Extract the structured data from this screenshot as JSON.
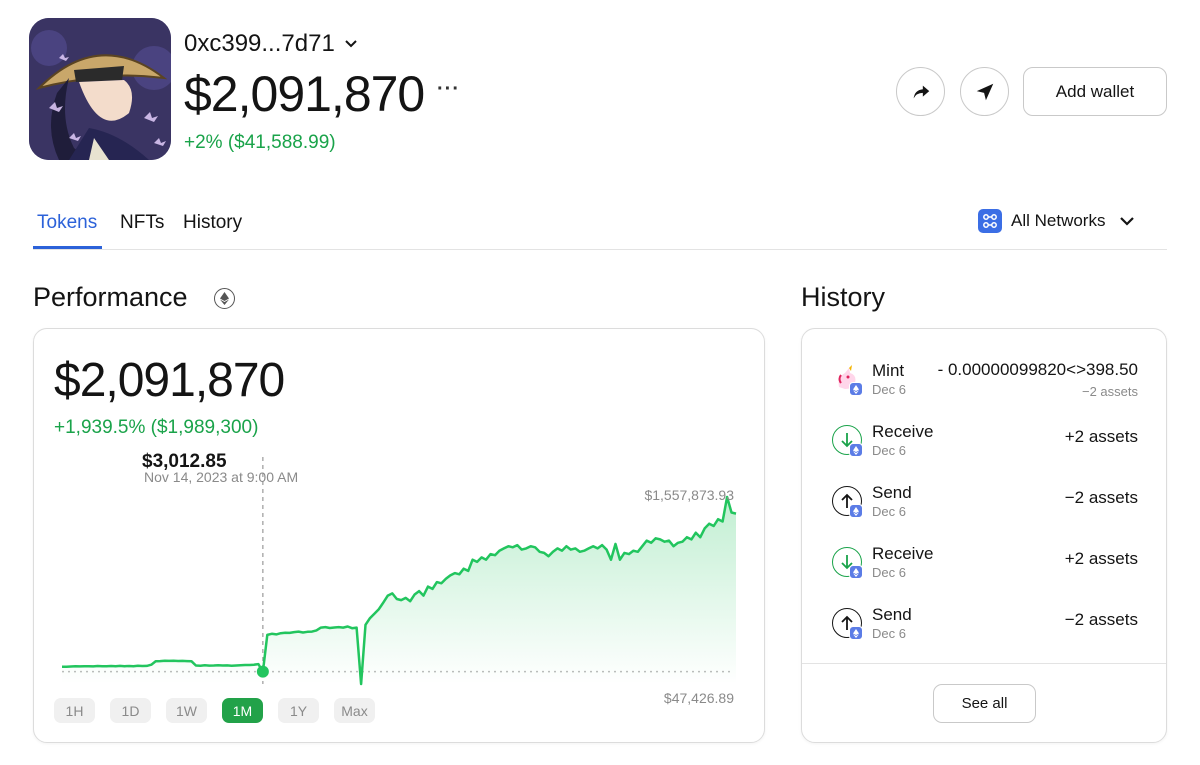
{
  "wallet": {
    "address": "0xc399...7d71",
    "balance": "$2,091,870",
    "change": "+2% ($41,588.99)",
    "more_label": "···",
    "add_wallet_label": "Add wallet"
  },
  "tabs": [
    {
      "label": "Tokens",
      "active": true
    },
    {
      "label": "NFTs",
      "active": false
    },
    {
      "label": "History",
      "active": false
    }
  ],
  "network_filter": {
    "label": "All Networks"
  },
  "performance": {
    "title": "Performance",
    "value": "$2,091,870",
    "change": "+1,939.5% ($1,989,300)",
    "hover_value": "$3,012.85",
    "hover_date": "Nov 14, 2023 at 9:00 AM",
    "max_label": "$1,557,873.93",
    "min_label": "$47,426.89",
    "ranges": [
      {
        "label": "1H",
        "active": false
      },
      {
        "label": "1D",
        "active": false
      },
      {
        "label": "1W",
        "active": false
      },
      {
        "label": "1M",
        "active": true
      },
      {
        "label": "1Y",
        "active": false
      },
      {
        "label": "Max",
        "active": false
      }
    ]
  },
  "history": {
    "title": "History",
    "see_all_label": "See all",
    "items": [
      {
        "type": "Mint",
        "date": "Dec 6",
        "amount": "- 0.00000099820<>398.50",
        "sub": "−2 assets",
        "icon": "unicorn-icon"
      },
      {
        "type": "Receive",
        "date": "Dec 6",
        "amount": "+2 assets",
        "sub": "",
        "icon": "arrow-down-icon"
      },
      {
        "type": "Send",
        "date": "Dec 6",
        "amount": "−2 assets",
        "sub": "",
        "icon": "arrow-up-icon"
      },
      {
        "type": "Receive",
        "date": "Dec 6",
        "amount": "+2 assets",
        "sub": "",
        "icon": "arrow-down-icon"
      },
      {
        "type": "Send",
        "date": "Dec 6",
        "amount": "−2 assets",
        "sub": "",
        "icon": "arrow-up-icon"
      }
    ]
  },
  "colors": {
    "accent_blue": "#2c62d9",
    "positive_green": "#1aa34a",
    "chart_line": "#22c55e",
    "network_icon": "#3b6ee5"
  },
  "chart_data": {
    "type": "line",
    "series": [
      {
        "values": [
          47427,
          47427,
          49000,
          51000,
          50000,
          51000,
          52000,
          50000,
          53000,
          52000,
          51000,
          53000,
          52000,
          54000,
          52000,
          53000,
          52000,
          55000,
          53000,
          54000,
          65000,
          95000,
          97000,
          100000,
          99000,
          100000,
          98000,
          99000,
          97000,
          96000,
          58000,
          56000,
          60000,
          57000,
          58000,
          60000,
          58000,
          59000,
          56000,
          58000,
          60000,
          62000,
          62000,
          65000,
          70000,
          3012.85,
          330000,
          340000,
          335000,
          345000,
          350000,
          348000,
          355000,
          360000,
          352000,
          358000,
          360000,
          370000,
          395000,
          400000,
          392000,
          396000,
          400000,
          395000,
          405000,
          390000,
          395000,
          0,
          420000,
          480000,
          520000,
          560000,
          620000,
          680000,
          700000,
          650000,
          640000,
          660000,
          630000,
          690000,
          720000,
          680000,
          760000,
          740000,
          800000,
          790000,
          830000,
          860000,
          880000,
          870000,
          920000,
          900000,
          1000000,
          980000,
          1020000,
          1000000,
          1050000,
          1040000,
          1080000,
          1100000,
          1120000,
          1110000,
          1130000,
          1090000,
          1100000,
          1120000,
          1110000,
          1070000,
          1060000,
          1030000,
          1070000,
          1100000,
          1080000,
          1120000,
          1090000,
          1100000,
          1070000,
          1080000,
          1100000,
          1120000,
          1100000,
          1130000,
          1090000,
          1000000,
          1140000,
          1000000,
          1060000,
          1050000,
          1080000,
          1070000,
          1120000,
          1170000,
          1150000,
          1190000,
          1180000,
          1160000,
          1170000,
          1120000,
          1150000,
          1160000,
          1200000,
          1180000,
          1240000,
          1200000,
          1280000,
          1320000,
          1300000,
          1360000,
          1340000,
          1557874,
          1420000,
          1410000
        ]
      }
    ],
    "hover_index": 45,
    "ylim": [
      0,
      1557874
    ]
  }
}
